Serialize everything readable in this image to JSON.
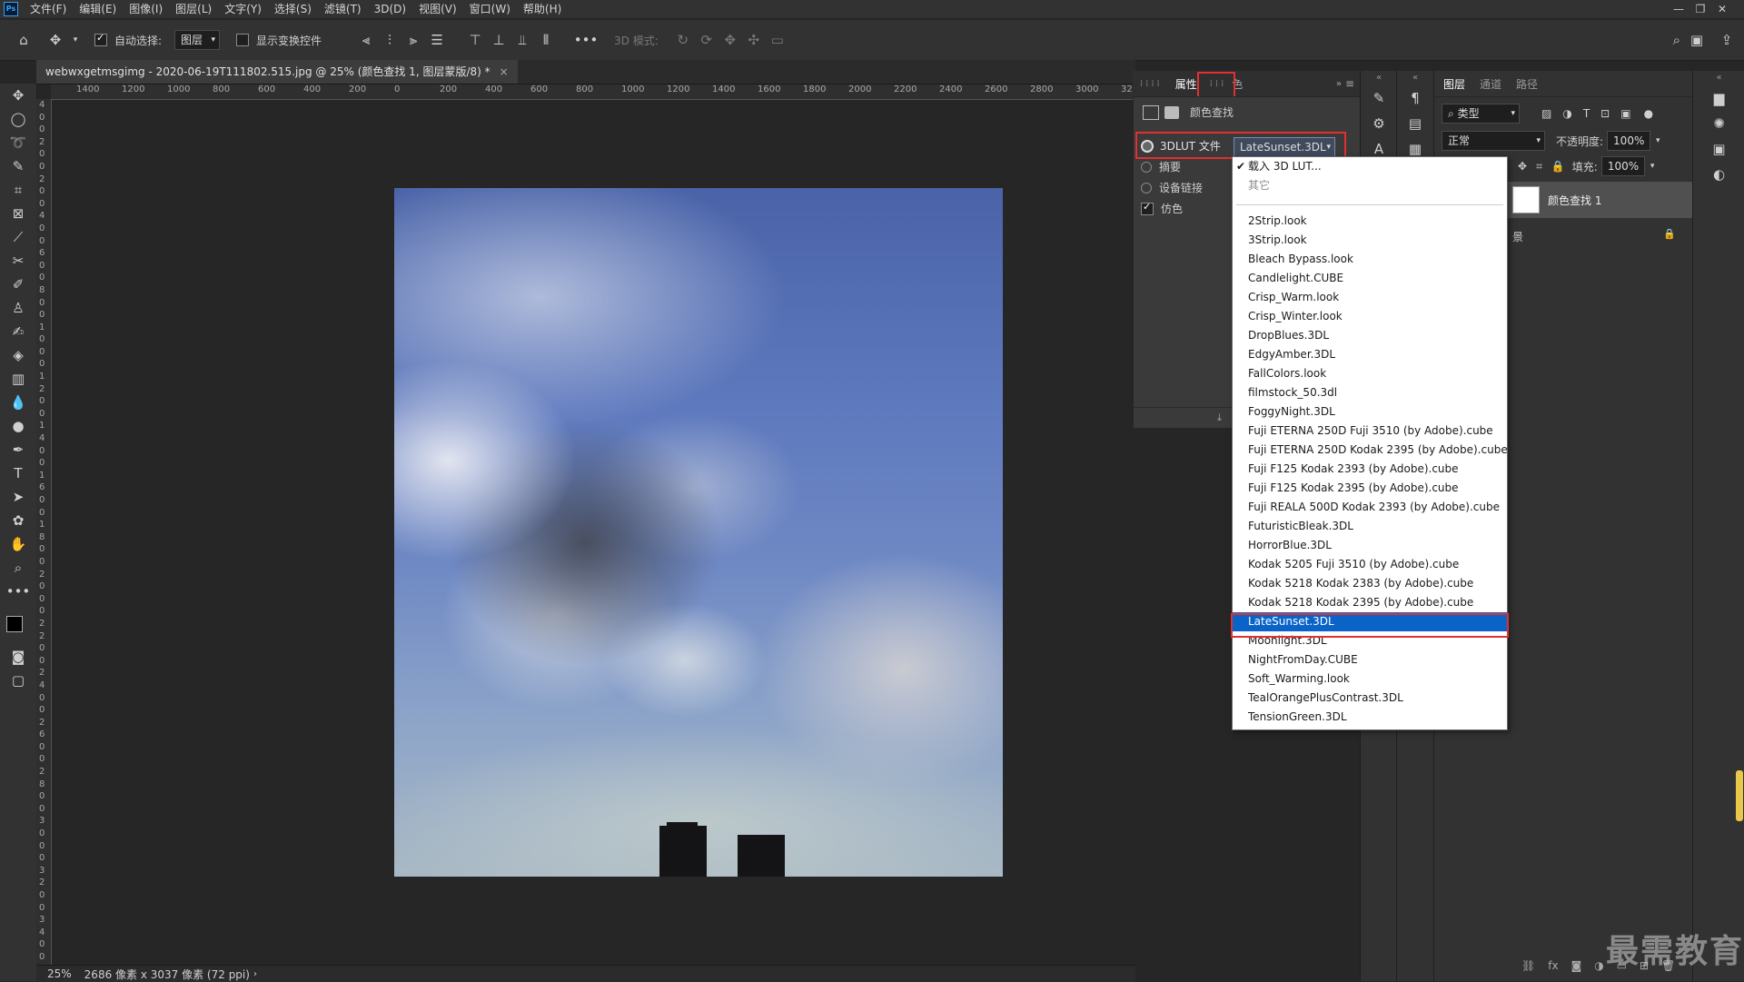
{
  "menubar": {
    "items": [
      "文件(F)",
      "编辑(E)",
      "图像(I)",
      "图层(L)",
      "文字(Y)",
      "选择(S)",
      "滤镜(T)",
      "3D(D)",
      "视图(V)",
      "窗口(W)",
      "帮助(H)"
    ],
    "window_controls": [
      "—",
      "❐",
      "✕"
    ]
  },
  "options": {
    "auto_select_label": "自动选择:",
    "auto_select_target": "图层",
    "show_transform_label": "显示变换控件",
    "mode_3d_label": "3D 模式:"
  },
  "document": {
    "tab_title": "webwxgetmsgimg - 2020-06-19T111802.515.jpg @ 25% (颜色查找 1, 图层蒙版/8) *",
    "close": "×"
  },
  "ruler": {
    "top_ticks": [
      "1400",
      "1200",
      "1000",
      "800",
      "600",
      "400",
      "200",
      "0",
      "200",
      "400",
      "600",
      "800",
      "1000",
      "1200",
      "1400",
      "1600",
      "1800",
      "2000",
      "2200",
      "2400",
      "2600",
      "2800",
      "3000",
      "32"
    ],
    "left_ticks": [
      "4",
      "0",
      "0",
      "2",
      "0",
      "0",
      "2",
      "0",
      "0",
      "4",
      "0",
      "0",
      "6",
      "0",
      "0",
      "8",
      "0",
      "0",
      "1",
      "0",
      "0",
      "0",
      "1",
      "2",
      "0",
      "0",
      "1",
      "4",
      "0",
      "0",
      "1",
      "6",
      "0",
      "0",
      "1",
      "8",
      "0",
      "0",
      "2",
      "0",
      "0",
      "0",
      "2",
      "2",
      "0",
      "0",
      "2",
      "4",
      "0",
      "0",
      "2",
      "6",
      "0",
      "0",
      "2",
      "8",
      "0",
      "0",
      "3",
      "0",
      "0",
      "0",
      "3",
      "2",
      "0",
      "0",
      "3",
      "4",
      "0",
      "0"
    ]
  },
  "properties": {
    "tab_label": "属性",
    "panel_title": "颜色查找",
    "lut_file_label": "3DLUT 文件",
    "lut_selected": "LateSunset.3DL",
    "abstract_label": "摘要",
    "device_link_label": "设备链接",
    "dither_label": "仿色",
    "tab_partial": "色"
  },
  "dropdown": {
    "load_item": "载入 3D LUT...",
    "other_item": "其它",
    "selected": "LateSunset.3DL",
    "items": [
      "2Strip.look",
      "3Strip.look",
      "Bleach Bypass.look",
      "Candlelight.CUBE",
      "Crisp_Warm.look",
      "Crisp_Winter.look",
      "DropBlues.3DL",
      "EdgyAmber.3DL",
      "FallColors.look",
      "filmstock_50.3dl",
      "FoggyNight.3DL",
      "Fuji ETERNA 250D Fuji 3510 (by Adobe).cube",
      "Fuji ETERNA 250D Kodak 2395 (by Adobe).cube",
      "Fuji F125 Kodak 2393 (by Adobe).cube",
      "Fuji F125 Kodak 2395 (by Adobe).cube",
      "Fuji REALA 500D Kodak 2393 (by Adobe).cube",
      "FuturisticBleak.3DL",
      "HorrorBlue.3DL",
      "Kodak 5205 Fuji 3510 (by Adobe).cube",
      "Kodak 5218 Kodak 2383 (by Adobe).cube",
      "Kodak 5218 Kodak 2395 (by Adobe).cube",
      "LateSunset.3DL",
      "Moonlight.3DL",
      "NightFromDay.CUBE",
      "Soft_Warming.look",
      "TealOrangePlusContrast.3DL",
      "TensionGreen.3DL"
    ]
  },
  "layers": {
    "tabs": [
      "图层",
      "通道",
      "路径"
    ],
    "filter_kind": "类型",
    "blend_mode": "正常",
    "opacity_label": "不透明度:",
    "opacity_value": "100%",
    "fill_label": "填充:",
    "fill_value": "100%",
    "layer_name": "颜色查找 1",
    "bg_layer_partial": "景"
  },
  "status": {
    "zoom": "25%",
    "info": "2686 像素 x 3037 像素 (72 ppi)"
  },
  "watermark": "最需教育",
  "colors": {
    "selection_blue": "#0a64c8",
    "highlight_red": "#e03030",
    "panel_bg": "#323232"
  }
}
